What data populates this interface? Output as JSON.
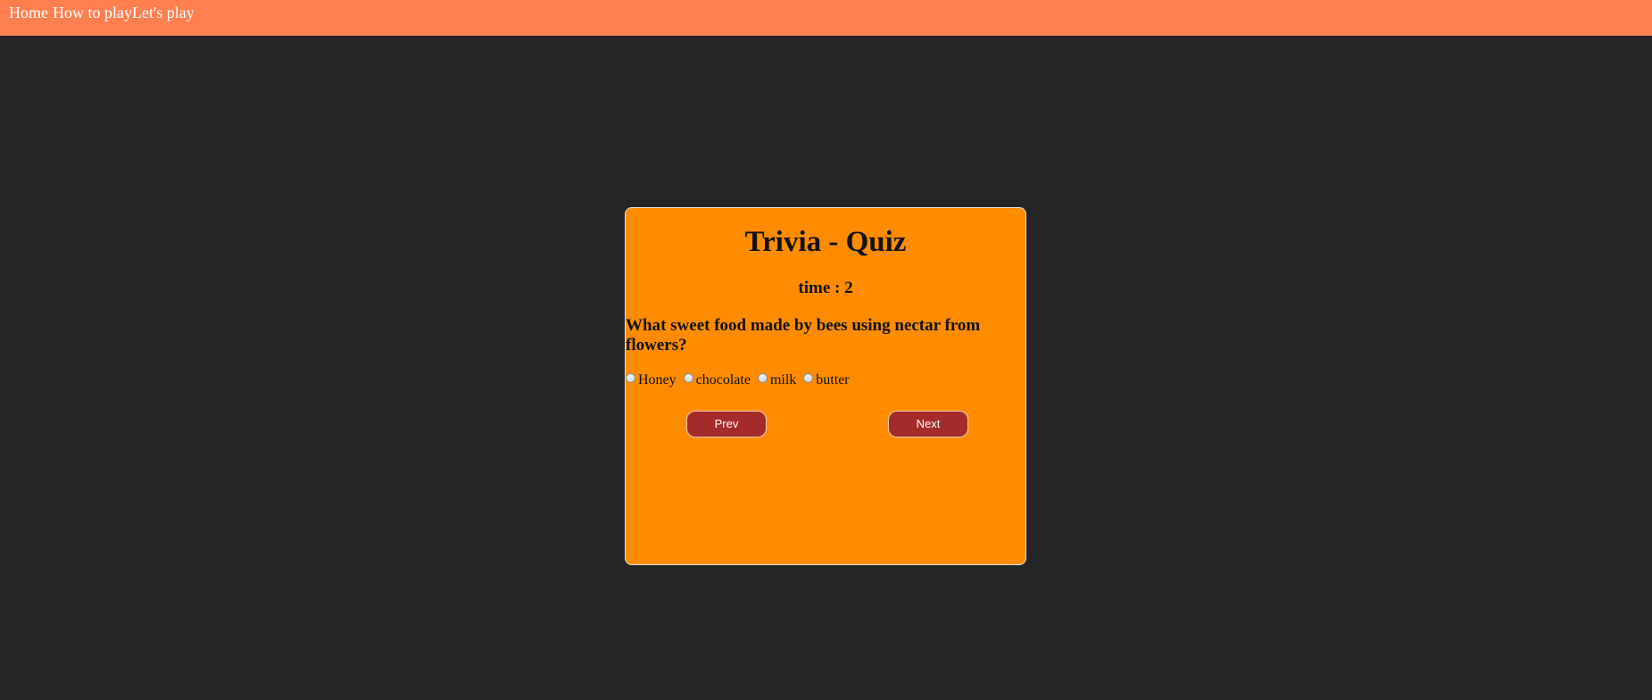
{
  "nav": {
    "home": "Home",
    "how_to_play": "How to play",
    "lets_play": "Let's play"
  },
  "quiz": {
    "title": "Trivia - Quiz",
    "timer_text": "time : 2",
    "question": "What sweet food made by bees using nectar from flowers?",
    "options": [
      "Honey",
      "chocolate",
      "milk",
      "butter"
    ],
    "prev_label": "Prev",
    "next_label": "Next"
  },
  "colors": {
    "background": "#262525",
    "nav_bar": "#ff7f50",
    "card": "#ff8c00",
    "button": "#a52a2a"
  }
}
